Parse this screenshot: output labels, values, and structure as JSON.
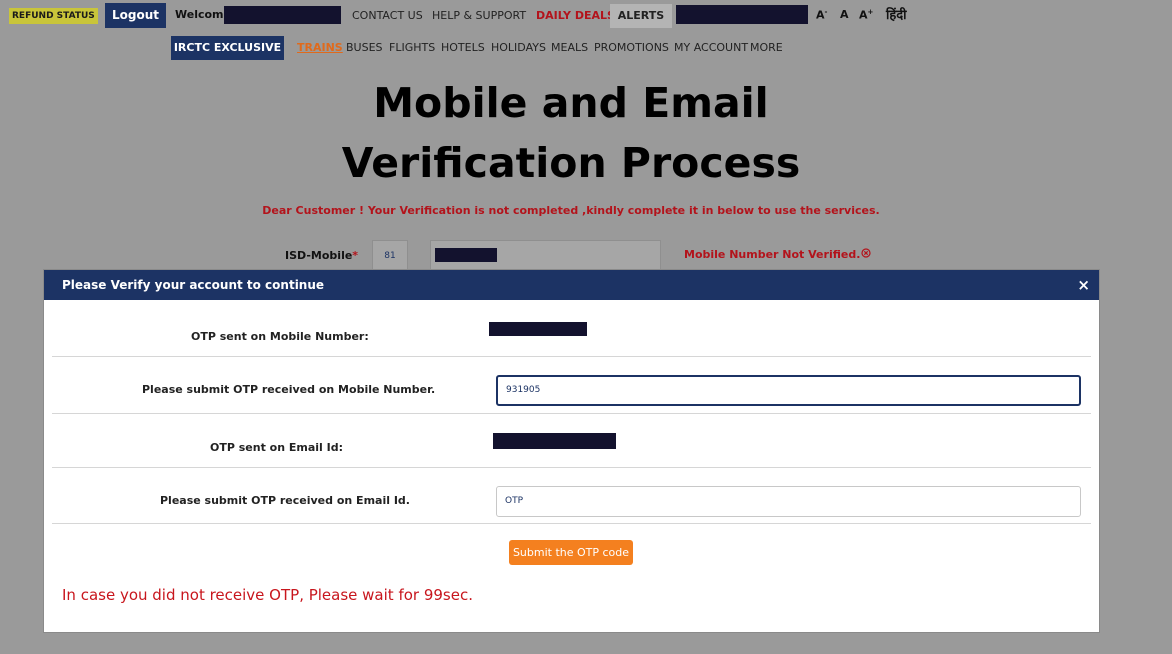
{
  "header": {
    "refund_status": "REFUND STATUS",
    "logout": "Logout",
    "welcome": "Welcome",
    "links": {
      "contact": "CONTACT US",
      "help": "HELP & SUPPORT",
      "deals": "DAILY DEALS",
      "alerts": "ALERTS"
    },
    "font_size": {
      "small": "A",
      "small_sup": "-",
      "normal": "A",
      "large": "A",
      "large_sup": "+"
    },
    "language": "हिंदी"
  },
  "nav": {
    "exclusive": "IRCTC EXCLUSIVE",
    "items": [
      "TRAINS",
      "BUSES",
      "FLIGHTS",
      "HOTELS",
      "HOLIDAYS",
      "MEALS",
      "PROMOTIONS",
      "MY ACCOUNT",
      "MORE"
    ],
    "active_item": "TRAINS"
  },
  "page": {
    "title_line1": "Mobile and Email",
    "title_line2": "Verification Process",
    "warning": "Dear Customer ! Your Verification is not completed ,kindly complete it in below to use the services.",
    "isd_label": "ISD-Mobile",
    "isd_required": "*",
    "isd_code": "81",
    "mobile_status": "Mobile Number Not Verified."
  },
  "modal": {
    "title": "Please Verify your account to continue",
    "close": "×",
    "otp_mobile_label": "OTP sent on Mobile Number:",
    "submit_mobile_label": "Please submit OTP received on Mobile Number.",
    "mobile_otp_value": "931905",
    "otp_email_label": "OTP sent on Email Id:",
    "submit_email_label": "Please submit OTP received on Email Id.",
    "email_otp_placeholder": "OTP",
    "submit_button": "Submit the OTP code",
    "wait_message": "In case you did not receive OTP, Please wait for 99sec."
  },
  "colors": {
    "navy": "#1c3364",
    "orange": "#f4801f",
    "error_red": "#c8161d",
    "overlay_gray": "#9a9a9a"
  }
}
